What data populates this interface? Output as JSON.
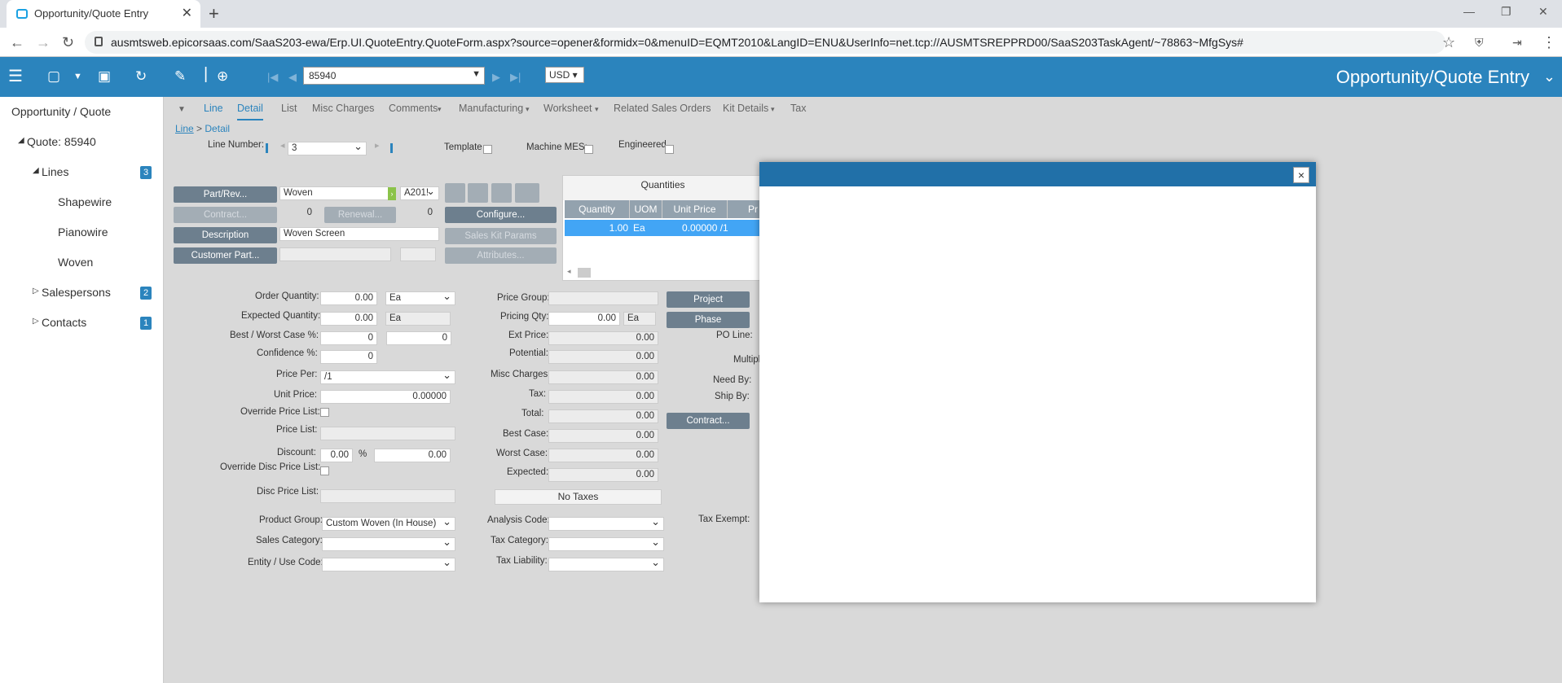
{
  "browser": {
    "tab_title": "Opportunity/Quote Entry",
    "url": "ausmtsweb.epicorsaas.com/SaaS203-ewa/Erp.UI.QuoteEntry.QuoteForm.aspx?source=opener&formidx=0&menuID=EQMT2010&LangID=ENU&UserInfo=net.tcp://AUSMTSREPPRD00/SaaS203TaskAgent/~78863~MfgSys#"
  },
  "toolbar": {
    "quote_number": "85940",
    "currency": "USD",
    "app_title": "Opportunity/Quote Entry"
  },
  "sidebar": {
    "root": "Opportunity / Quote",
    "quote": "Quote: 85940",
    "lines_label": "Lines",
    "lines_count": "3",
    "line_items": [
      "Shapewire",
      "Pianowire",
      "Woven"
    ],
    "salespersons_label": "Salespersons",
    "salespersons_count": "2",
    "contacts_label": "Contacts",
    "contacts_count": "1"
  },
  "tabs": [
    "Line",
    "Detail",
    "List",
    "Misc Charges",
    "Comments",
    "Manufacturing",
    "Worksheet",
    "Related Sales Orders",
    "Kit Details",
    "Tax"
  ],
  "breadcrumb": {
    "parent": "Line",
    "sep": ">",
    "current": "Detail"
  },
  "form": {
    "line_number_label": "Line Number:",
    "line_number": "3",
    "template_label": "Template",
    "machine_mes_label": "Machine MES:",
    "engineered_label": "Engineered",
    "part_rev_btn": "Part/Rev...",
    "part_value": "Woven",
    "rev_value": "A201!",
    "contract_btn": "Contract...",
    "contract_value": "0",
    "renewal_btn": "Renewal...",
    "renewal_value": "0",
    "configure_btn": "Configure...",
    "description_btn": "Description",
    "description_value": "Woven Screen",
    "sales_kit_btn": "Sales Kit Params",
    "customer_part_btn": "Customer Part...",
    "attributes_btn": "Attributes...",
    "quantities_title": "Quantities",
    "grid_headers": [
      "Quantity",
      "UOM",
      "Unit Price",
      "Pr"
    ],
    "grid_row": [
      "1.00",
      "Ea",
      "0.00000 /1"
    ],
    "order_qty_label": "Order Quantity:",
    "order_qty": "0.00",
    "order_uom": "Ea",
    "expected_qty_label": "Expected Quantity:",
    "expected_qty": "0.00",
    "expected_uom": "Ea",
    "best_worst_label": "Best / Worst Case %:",
    "best_pct": "0",
    "worst_pct": "0",
    "confidence_label": "Confidence %:",
    "confidence": "0",
    "price_per_label": "Price Per:",
    "price_per": "/1",
    "unit_price_label": "Unit Price:",
    "unit_price": "0.00000",
    "override_price_list_label": "Override Price List:",
    "price_list_label": "Price List:",
    "discount_label": "Discount:",
    "discount_pct": "0.00",
    "pct_sign": "%",
    "discount_amt": "0.00",
    "override_disc_label": "Override Disc Price List:",
    "disc_price_list_label": "Disc Price List:",
    "price_group_label": "Price Group:",
    "pricing_qty_label": "Pricing Qty:",
    "pricing_qty": "0.00",
    "pricing_uom": "Ea",
    "ext_price_label": "Ext Price:",
    "ext_price": "0.00",
    "potential_label": "Potential:",
    "potential": "0.00",
    "misc_charges_label": "Misc Charges:",
    "misc_charges": "0.00",
    "tax_label": "Tax:",
    "tax": "0.00",
    "total_label": "Total:",
    "total": "0.00",
    "best_case_label": "Best Case:",
    "best_case": "0.00",
    "worst_case_label": "Worst Case:",
    "worst_case": "0.00",
    "expected_label": "Expected:",
    "expected": "0.00",
    "no_taxes": "No Taxes",
    "project_btn": "Project",
    "phase_btn": "Phase",
    "po_line_label": "PO Line:",
    "multip_label": "Multipl",
    "need_by_label": "Need By:",
    "ship_by_label": "Ship By:",
    "contract2_btn": "Contract...",
    "product_group_label": "Product Group:",
    "product_group": "Custom Woven (In House)",
    "sales_category_label": "Sales Category:",
    "entity_use_label": "Entity / Use Code:",
    "analysis_code_label": "Analysis Code:",
    "tax_category_label": "Tax Category:",
    "tax_liability_label": "Tax Liability:",
    "tax_exempt_label": "Tax Exempt:"
  },
  "modal": {
    "close": "×"
  }
}
